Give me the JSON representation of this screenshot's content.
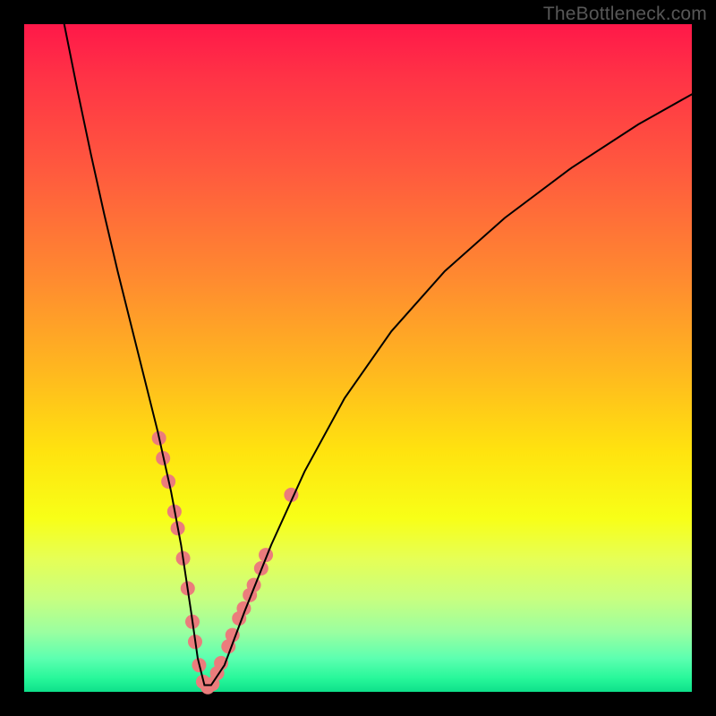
{
  "watermark": "TheBottleneck.com",
  "chart_data": {
    "type": "line",
    "title": "",
    "xlabel": "",
    "ylabel": "",
    "xlim": [
      0,
      100
    ],
    "ylim": [
      0,
      100
    ],
    "grid": false,
    "legend": false,
    "background_gradient": {
      "direction": "vertical",
      "stops": [
        {
          "pos": 0.0,
          "color": "#ff1849"
        },
        {
          "pos": 0.38,
          "color": "#ff8a30"
        },
        {
          "pos": 0.64,
          "color": "#ffe30f"
        },
        {
          "pos": 0.86,
          "color": "#c8ff80"
        },
        {
          "pos": 1.0,
          "color": "#0ee08a"
        }
      ]
    },
    "series": [
      {
        "name": "bottleneck-curve",
        "stroke": "#000000",
        "stroke_width": 2,
        "x": [
          6,
          8,
          10,
          12,
          14,
          16,
          18,
          20,
          22,
          23.5,
          25,
          26,
          27,
          28,
          30,
          33,
          37,
          42,
          48,
          55,
          63,
          72,
          82,
          92,
          100
        ],
        "values": [
          100,
          90,
          80.5,
          71.5,
          63,
          55,
          47,
          39,
          30,
          22,
          12,
          5,
          1,
          1,
          4,
          12,
          22,
          33,
          44,
          54,
          63,
          71,
          78.5,
          85,
          89.5
        ]
      }
    ],
    "scatter": [
      {
        "name": "curve-markers",
        "color": "#eb7c7c",
        "radius": 8,
        "points": [
          {
            "x": 20.2,
            "y": 38
          },
          {
            "x": 20.8,
            "y": 35
          },
          {
            "x": 21.6,
            "y": 31.5
          },
          {
            "x": 22.5,
            "y": 27
          },
          {
            "x": 23.0,
            "y": 24.5
          },
          {
            "x": 23.8,
            "y": 20
          },
          {
            "x": 24.5,
            "y": 15.5
          },
          {
            "x": 25.2,
            "y": 10.5
          },
          {
            "x": 25.6,
            "y": 7.5
          },
          {
            "x": 26.2,
            "y": 4
          },
          {
            "x": 26.8,
            "y": 1.5
          },
          {
            "x": 27.5,
            "y": 0.7
          },
          {
            "x": 28.2,
            "y": 1.2
          },
          {
            "x": 28.9,
            "y": 2.8
          },
          {
            "x": 29.5,
            "y": 4.3
          },
          {
            "x": 30.6,
            "y": 6.8
          },
          {
            "x": 31.2,
            "y": 8.5
          },
          {
            "x": 32.2,
            "y": 11
          },
          {
            "x": 32.9,
            "y": 12.5
          },
          {
            "x": 33.8,
            "y": 14.5
          },
          {
            "x": 34.4,
            "y": 16
          },
          {
            "x": 35.5,
            "y": 18.5
          },
          {
            "x": 36.2,
            "y": 20.5
          },
          {
            "x": 40.0,
            "y": 29.5
          }
        ]
      }
    ]
  }
}
